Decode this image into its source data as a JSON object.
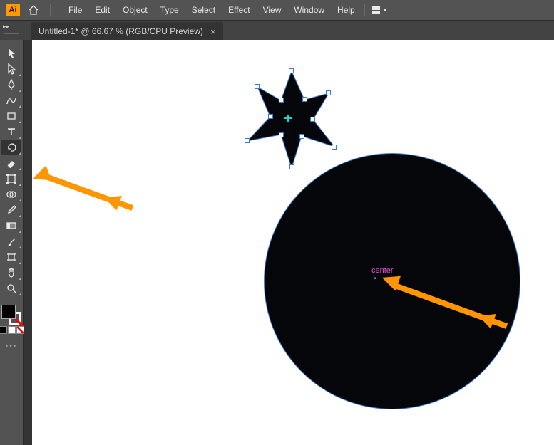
{
  "app": {
    "logo_text": "Ai"
  },
  "menu": {
    "items": [
      "File",
      "Edit",
      "Object",
      "Type",
      "Select",
      "Effect",
      "View",
      "Window",
      "Help"
    ]
  },
  "tab": {
    "title": "Untitled-1* @ 66.67 % (RGB/CPU Preview)"
  },
  "tools": [
    {
      "name": "selection-tool",
      "icon": "cursor",
      "sub": false,
      "selected": false
    },
    {
      "name": "direct-selection-tool",
      "icon": "cursor-white",
      "sub": true,
      "selected": false
    },
    {
      "name": "pen-tool",
      "icon": "pen",
      "sub": true,
      "selected": false
    },
    {
      "name": "curvature-tool",
      "icon": "curvature",
      "sub": true,
      "selected": false
    },
    {
      "name": "rectangle-tool",
      "icon": "rect",
      "sub": true,
      "selected": false
    },
    {
      "name": "type-tool",
      "icon": "type",
      "sub": true,
      "selected": false
    },
    {
      "name": "rotate-tool",
      "icon": "rotate",
      "sub": true,
      "selected": true
    },
    {
      "name": "eraser-tool",
      "icon": "eraser",
      "sub": true,
      "selected": false
    },
    {
      "name": "free-transform-tool",
      "icon": "transform",
      "sub": true,
      "selected": false
    },
    {
      "name": "shape-builder-tool",
      "icon": "shapebuilder",
      "sub": true,
      "selected": false
    },
    {
      "name": "eyedropper-tool",
      "icon": "eyedropper",
      "sub": true,
      "selected": false
    },
    {
      "name": "gradient-tool",
      "icon": "gradient",
      "sub": true,
      "selected": false
    },
    {
      "name": "paintbrush-tool",
      "icon": "brush",
      "sub": true,
      "selected": false
    },
    {
      "name": "artboard-tool",
      "icon": "artboard",
      "sub": true,
      "selected": false
    },
    {
      "name": "hand-tool",
      "icon": "hand",
      "sub": true,
      "selected": false
    },
    {
      "name": "zoom-tool",
      "icon": "zoom",
      "sub": true,
      "selected": false
    }
  ],
  "canvas": {
    "center_label": "center"
  }
}
